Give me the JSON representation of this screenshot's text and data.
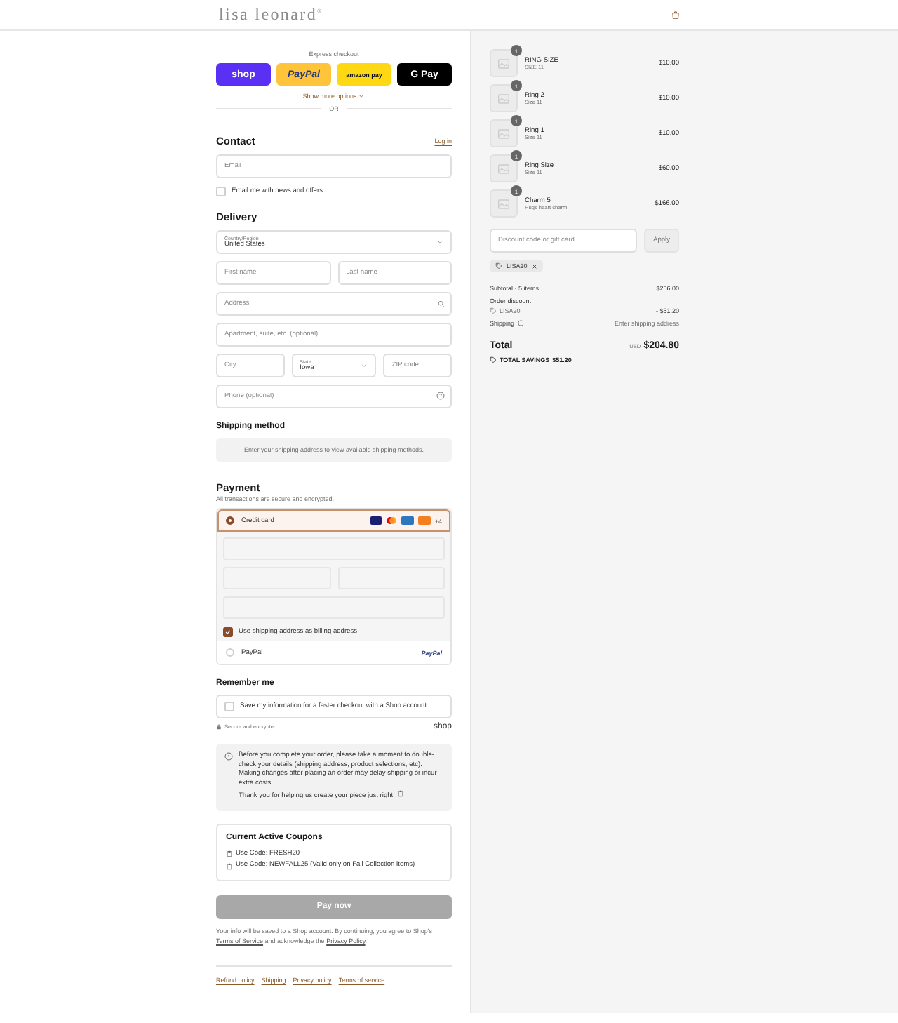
{
  "header": {
    "logo": "lisa leonard",
    "logo_mark": "®"
  },
  "express": {
    "label": "Express checkout",
    "buttons": [
      {
        "kind": "shop",
        "label": "shop"
      },
      {
        "kind": "paypal",
        "label": "PayPal"
      },
      {
        "kind": "amazon",
        "label": "amazon pay"
      },
      {
        "kind": "gpay",
        "label": "G Pay"
      }
    ],
    "more": "Show more options",
    "divider": "OR"
  },
  "contact": {
    "title": "Contact",
    "login": "Log in",
    "email": {
      "placeholder": "Email"
    },
    "newsletter": {
      "label": "Email me with news and offers",
      "checked": false
    }
  },
  "delivery": {
    "title": "Delivery",
    "rows": [
      [
        {
          "kind": "select",
          "label": "Country/Region",
          "value": "United States"
        }
      ],
      [
        {
          "kind": "input",
          "placeholder": "First name"
        },
        {
          "kind": "input",
          "placeholder": "Last name"
        }
      ],
      [
        {
          "kind": "search",
          "placeholder": "Address"
        }
      ],
      [
        {
          "kind": "input",
          "placeholder": "Apartment, suite, etc. (optional)"
        }
      ],
      [
        {
          "kind": "input",
          "placeholder": "City"
        },
        {
          "kind": "select",
          "label": "State",
          "value": "Iowa"
        },
        {
          "kind": "input",
          "placeholder": "ZIP code"
        }
      ],
      [
        {
          "kind": "help",
          "placeholder": "Phone (optional)"
        }
      ]
    ]
  },
  "shipping": {
    "title": "Shipping method",
    "message": "Enter your shipping address to view available shipping methods."
  },
  "payment": {
    "title": "Payment",
    "subtitle": "All transactions are secure and encrypted.",
    "methods": [
      {
        "kind": "card",
        "label": "Credit card",
        "selected": true,
        "more": "+4",
        "billing": {
          "label": "Use shipping address as billing address",
          "checked": true
        }
      },
      {
        "kind": "paypal",
        "label": "PayPal",
        "selected": false,
        "badge": "PayPal"
      }
    ]
  },
  "remember": {
    "title": "Remember me",
    "save": {
      "label": "Save my information for a faster checkout with a Shop account",
      "checked": false
    },
    "secure": "Secure and encrypted",
    "brand": "shop"
  },
  "notice": {
    "lines": [
      "Before you complete your order, please take a moment to double-check your details (shipping address, product selections, etc). Making changes after placing an order may delay shipping or incur extra costs.",
      "Thank you for helping us create your piece just right!"
    ]
  },
  "coupons": {
    "title": "Current Active Coupons",
    "lines": [
      "Use Code: FRESH20",
      "Use Code: NEWFALL25 (Valid only on Fall Collection items)"
    ]
  },
  "pay": {
    "label": "Pay now",
    "disabled": true
  },
  "legal": [
    {
      "kind": "text",
      "text": "Your info will be saved to a Shop account. By continuing, you agree to Shop's"
    },
    {
      "kind": "link",
      "text": "Terms of Service"
    },
    {
      "kind": "text",
      "text": "and acknowledge the"
    },
    {
      "kind": "link",
      "text": "Privacy Policy"
    },
    {
      "kind": "text",
      "text": "."
    }
  ],
  "footer_links": [
    "Refund policy",
    "Shipping",
    "Privacy policy",
    "Terms of service"
  ],
  "summary": {
    "items": [
      {
        "name": "RING SIZE",
        "variant": "SIZE 11",
        "price": "$10.00",
        "quantity": "1"
      },
      {
        "name": "Ring 2",
        "variant": "Size 11",
        "price": "$10.00",
        "quantity": "1"
      },
      {
        "name": "Ring 1",
        "variant": "Size 11",
        "price": "$10.00",
        "quantity": "1"
      },
      {
        "name": "Ring Size",
        "variant": "Size 11",
        "price": "$60.00",
        "quantity": "1"
      },
      {
        "name": "Charm 5",
        "variant": "Hugs heart charm",
        "price": "$166.00",
        "quantity": "1"
      }
    ],
    "discount": {
      "placeholder": "Discount code or gift card",
      "button": "Apply"
    },
    "applied_code": "LISA20",
    "subtotal": {
      "label": "Subtotal · 5 items",
      "value": "$256.00"
    },
    "order_discount": {
      "label": "Order discount",
      "code": "LISA20",
      "value": "- $51.20"
    },
    "shipping": {
      "label": "Shipping",
      "value": "Enter shipping address"
    },
    "total": {
      "label": "Total",
      "currency": "USD",
      "value": "$204.80"
    },
    "savings": {
      "label": "TOTAL SAVINGS",
      "value": "$51.20"
    }
  }
}
